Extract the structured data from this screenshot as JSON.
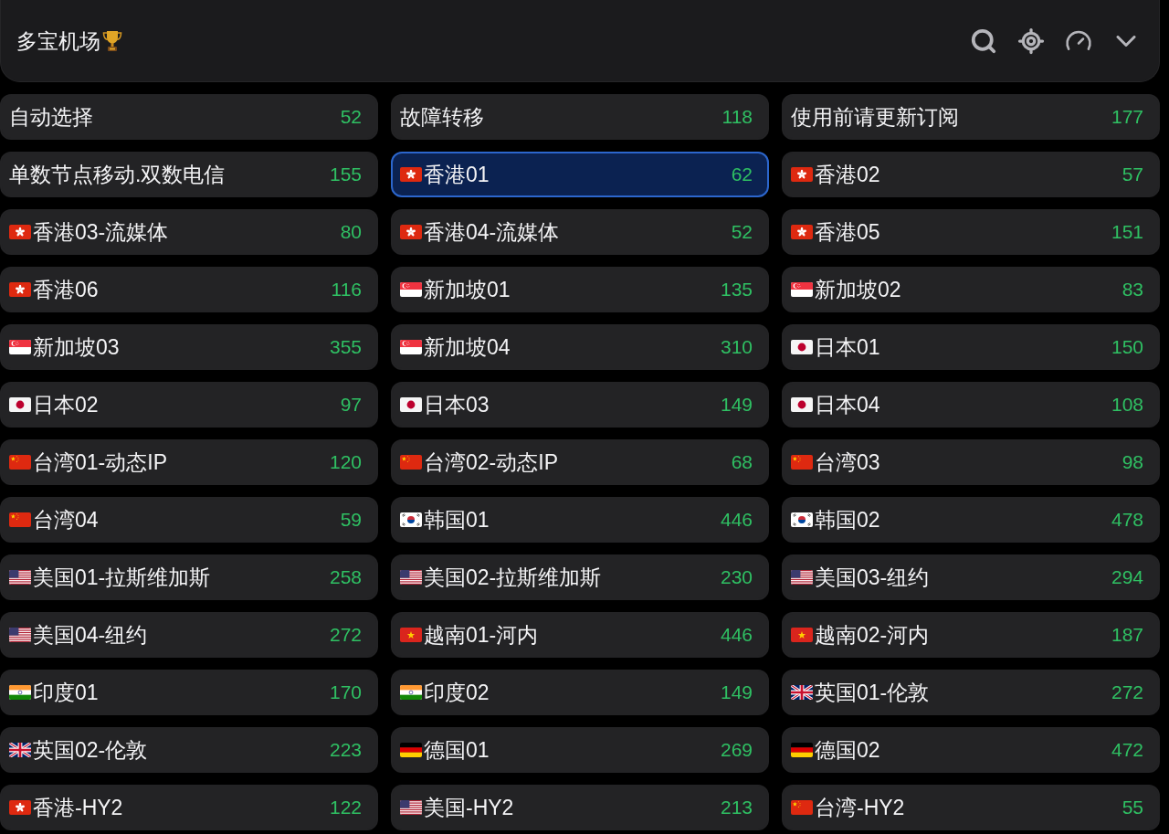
{
  "header": {
    "title": "多宝机场"
  },
  "proxies": [
    {
      "kind": "plain",
      "name": "自动选择",
      "delay": "52",
      "selected": false
    },
    {
      "kind": "plain",
      "name": "故障转移",
      "delay": "118",
      "selected": false
    },
    {
      "kind": "plain",
      "name": "使用前请更新订阅",
      "delay": "177",
      "selected": false
    },
    {
      "kind": "plain",
      "name": "单数节点移动.双数电信",
      "delay": "155",
      "selected": false
    },
    {
      "kind": "hk",
      "name": "香港01",
      "delay": "62",
      "selected": true
    },
    {
      "kind": "hk",
      "name": "香港02",
      "delay": "57",
      "selected": false
    },
    {
      "kind": "hk",
      "name": "香港03-流媒体",
      "delay": "80",
      "selected": false
    },
    {
      "kind": "hk",
      "name": "香港04-流媒体",
      "delay": "52",
      "selected": false
    },
    {
      "kind": "hk",
      "name": "香港05",
      "delay": "151",
      "selected": false
    },
    {
      "kind": "hk",
      "name": "香港06",
      "delay": "116",
      "selected": false
    },
    {
      "kind": "sg",
      "name": "新加坡01",
      "delay": "135",
      "selected": false
    },
    {
      "kind": "sg",
      "name": "新加坡02",
      "delay": "83",
      "selected": false
    },
    {
      "kind": "sg",
      "name": "新加坡03",
      "delay": "355",
      "selected": false
    },
    {
      "kind": "sg",
      "name": "新加坡04",
      "delay": "310",
      "selected": false
    },
    {
      "kind": "jp",
      "name": "日本01",
      "delay": "150",
      "selected": false
    },
    {
      "kind": "jp",
      "name": "日本02",
      "delay": "97",
      "selected": false
    },
    {
      "kind": "jp",
      "name": "日本03",
      "delay": "149",
      "selected": false
    },
    {
      "kind": "jp",
      "name": "日本04",
      "delay": "108",
      "selected": false
    },
    {
      "kind": "cn",
      "name": "台湾01-动态IP",
      "delay": "120",
      "selected": false
    },
    {
      "kind": "cn",
      "name": "台湾02-动态IP",
      "delay": "68",
      "selected": false
    },
    {
      "kind": "cn",
      "name": "台湾03",
      "delay": "98",
      "selected": false
    },
    {
      "kind": "cn",
      "name": "台湾04",
      "delay": "59",
      "selected": false
    },
    {
      "kind": "kr",
      "name": "韩国01",
      "delay": "446",
      "selected": false
    },
    {
      "kind": "kr",
      "name": "韩国02",
      "delay": "478",
      "selected": false
    },
    {
      "kind": "us",
      "name": "美国01-拉斯维加斯",
      "delay": "258",
      "selected": false
    },
    {
      "kind": "us",
      "name": "美国02-拉斯维加斯",
      "delay": "230",
      "selected": false
    },
    {
      "kind": "us",
      "name": "美国03-纽约",
      "delay": "294",
      "selected": false
    },
    {
      "kind": "us",
      "name": "美国04-纽约",
      "delay": "272",
      "selected": false
    },
    {
      "kind": "vn",
      "name": "越南01-河内",
      "delay": "446",
      "selected": false
    },
    {
      "kind": "vn",
      "name": "越南02-河内",
      "delay": "187",
      "selected": false
    },
    {
      "kind": "in",
      "name": "印度01",
      "delay": "170",
      "selected": false
    },
    {
      "kind": "in",
      "name": "印度02",
      "delay": "149",
      "selected": false
    },
    {
      "kind": "gb",
      "name": "英国01-伦敦",
      "delay": "272",
      "selected": false
    },
    {
      "kind": "gb",
      "name": "英国02-伦敦",
      "delay": "223",
      "selected": false
    },
    {
      "kind": "de",
      "name": "德国01",
      "delay": "269",
      "selected": false
    },
    {
      "kind": "de",
      "name": "德国02",
      "delay": "472",
      "selected": false
    },
    {
      "kind": "hk",
      "name": "香港-HY2",
      "delay": "122",
      "selected": false
    },
    {
      "kind": "us",
      "name": "美国-HY2",
      "delay": "213",
      "selected": false
    },
    {
      "kind": "cn",
      "name": "台湾-HY2",
      "delay": "55",
      "selected": false
    }
  ]
}
